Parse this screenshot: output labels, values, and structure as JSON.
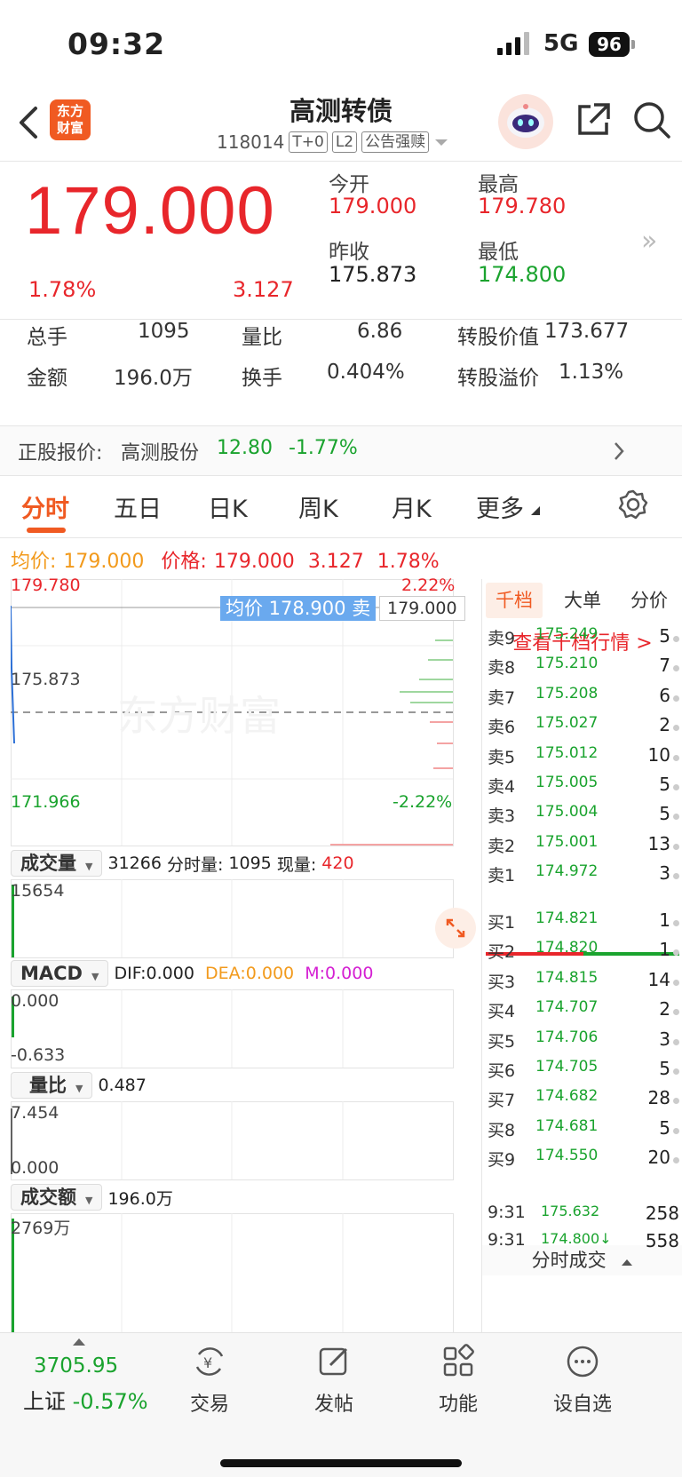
{
  "status": {
    "time": "09:32",
    "network": "5G",
    "battery": "96"
  },
  "header": {
    "logo": [
      "东方",
      "财富"
    ],
    "title": "高测转债",
    "code": "118014",
    "tags": [
      "T+0",
      "L2",
      "公告强赎"
    ]
  },
  "quote": {
    "price": "179.000",
    "change_pct": "1.78%",
    "change": "3.127",
    "open_label": "今开",
    "open": "179.000",
    "high_label": "最高",
    "high": "179.780",
    "prev_close_label": "昨收",
    "prev_close": "175.873",
    "low_label": "最低",
    "low": "174.800"
  },
  "stats": {
    "volume_label": "总手",
    "volume": "1095",
    "vol_ratio_label": "量比",
    "vol_ratio": "6.86",
    "conv_value_label": "转股价值",
    "conv_value": "173.677",
    "amount_label": "金额",
    "amount": "196.0万",
    "turnover_label": "换手",
    "turnover": "0.404%",
    "premium_label": "转股溢价",
    "premium": "1.13%"
  },
  "underlying": {
    "label": "正股报价:",
    "name": "高测股份",
    "price": "12.80",
    "change": "-1.77%"
  },
  "tabs": [
    "分时",
    "五日",
    "日K",
    "周K",
    "月K",
    "更多"
  ],
  "avg_line": {
    "avg_label": "均价:",
    "avg": "179.000",
    "price_label": "价格:",
    "price": "179.000",
    "change": "3.127",
    "pct": "1.78%"
  },
  "intraday": {
    "top": "179.780",
    "top_pct": "2.22%",
    "mid": "175.873",
    "bottom": "171.966",
    "bottom_pct": "-2.22%",
    "watermark": "东方财富",
    "tag_avg": "均价 178.900 卖",
    "tag_price": "179.000"
  },
  "volume_panel": {
    "name": "成交量",
    "total": "31266",
    "min_label": "分时量:",
    "min_val": "1095",
    "now_label": "现量:",
    "now_val": "420",
    "axis_top": "15654"
  },
  "macd_panel": {
    "name": "MACD",
    "dif": "DIF:0.000",
    "dea": "DEA:0.000",
    "m": "M:0.000",
    "axis_top": "0.000",
    "axis_bottom": "-0.633"
  },
  "ratio_panel": {
    "name": "量比",
    "value": "0.487",
    "axis_top": "7.454",
    "axis_bottom": "0.000"
  },
  "amount_panel": {
    "name": "成交额",
    "value": "196.0万",
    "axis_top": "2769万"
  },
  "book": {
    "tabs": [
      "千档",
      "大单",
      "分价"
    ],
    "link": "查看千档行情 >",
    "asks": [
      {
        "label": "卖9",
        "price": "175.249",
        "vol": "5"
      },
      {
        "label": "卖8",
        "price": "175.210",
        "vol": "7"
      },
      {
        "label": "卖7",
        "price": "175.208",
        "vol": "6"
      },
      {
        "label": "卖6",
        "price": "175.027",
        "vol": "2"
      },
      {
        "label": "卖5",
        "price": "175.012",
        "vol": "10"
      },
      {
        "label": "卖4",
        "price": "175.005",
        "vol": "5"
      },
      {
        "label": "卖3",
        "price": "175.004",
        "vol": "5"
      },
      {
        "label": "卖2",
        "price": "175.001",
        "vol": "13"
      },
      {
        "label": "卖1",
        "price": "174.972",
        "vol": "3"
      }
    ],
    "bids": [
      {
        "label": "买1",
        "price": "174.821",
        "vol": "1"
      },
      {
        "label": "买2",
        "price": "174.820",
        "vol": "1"
      },
      {
        "label": "买3",
        "price": "174.815",
        "vol": "14"
      },
      {
        "label": "买4",
        "price": "174.707",
        "vol": "2"
      },
      {
        "label": "买5",
        "price": "174.706",
        "vol": "3"
      },
      {
        "label": "买6",
        "price": "174.705",
        "vol": "5"
      },
      {
        "label": "买7",
        "price": "174.682",
        "vol": "28"
      },
      {
        "label": "买8",
        "price": "174.681",
        "vol": "5"
      },
      {
        "label": "买9",
        "price": "174.550",
        "vol": "20"
      }
    ],
    "ticks_label": "分时成交",
    "ticks": [
      {
        "time": "9:31",
        "price": "175.632",
        "vol": "258"
      },
      {
        "time": "9:31",
        "price": "174.800↓",
        "vol": "558"
      }
    ]
  },
  "bottom": {
    "index_value": "3705.95",
    "index_name": "上证",
    "index_change": "-0.57%",
    "buttons": [
      "交易",
      "发帖",
      "功能",
      "设自选"
    ]
  },
  "colors": {
    "up": "#e8262b",
    "down": "#1aa32e",
    "accent": "#f05a22",
    "avg": "#f29a1c"
  }
}
